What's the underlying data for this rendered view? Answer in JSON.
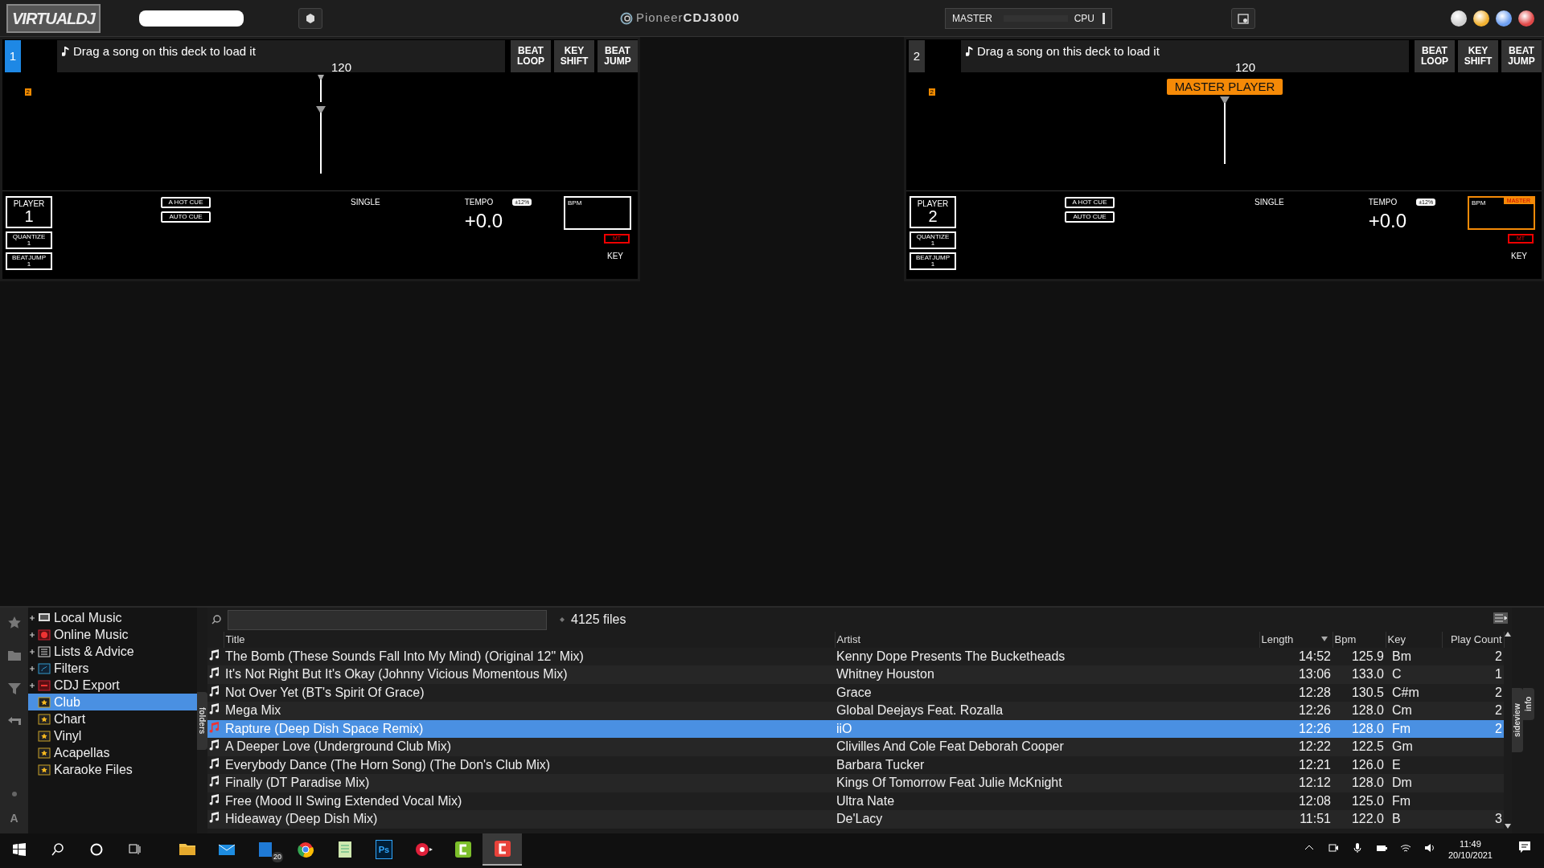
{
  "top_bar": {
    "logo": "VIRTUALDJ",
    "brand_prefix": "Pioneer",
    "brand_model": "CDJ3000",
    "master_label": "MASTER",
    "cpu_label": "CPU"
  },
  "decks": [
    {
      "number": "1",
      "selected": true,
      "master": false,
      "message": "Drag a song on this deck to load it",
      "bpm_display": "120",
      "buttons": [
        "BEAT LOOP",
        "KEY SHIFT",
        "BEAT JUMP"
      ],
      "cue_badge": "2",
      "player_label": "PLAYER",
      "player_number": "1",
      "quantize_label": "QUANTIZE",
      "quantize_value": "1",
      "beatjump_label": "BEATJUMP",
      "beatjump_value": "1",
      "cue_buttons": [
        "A HOT CUE",
        "AUTO CUE"
      ],
      "mode": "SINGLE",
      "tempo_label": "TEMPO",
      "tempo_range": "±12%",
      "tempo_value": "+0.0",
      "bpm_label": "BPM",
      "mt_label": "MT",
      "key_label": "KEY"
    },
    {
      "number": "2",
      "selected": false,
      "master": true,
      "master_player_label": "MASTER PLAYER",
      "master_badge": "MASTER",
      "message": "Drag a song on this deck to load it",
      "bpm_display": "120",
      "buttons": [
        "BEAT LOOP",
        "KEY SHIFT",
        "BEAT JUMP"
      ],
      "cue_badge": "2",
      "player_label": "PLAYER",
      "player_number": "2",
      "quantize_label": "QUANTIZE",
      "quantize_value": "1",
      "beatjump_label": "BEATJUMP",
      "beatjump_value": "1",
      "cue_buttons": [
        "A HOT CUE",
        "AUTO CUE"
      ],
      "mode": "SINGLE",
      "tempo_label": "TEMPO",
      "tempo_range": "±12%",
      "tempo_value": "+0.0",
      "bpm_label": "BPM",
      "mt_label": "MT",
      "key_label": "KEY"
    }
  ],
  "browser": {
    "tree": [
      {
        "label": "Local Music",
        "kind": "computer",
        "expandable": true,
        "selected": false
      },
      {
        "label": "Online Music",
        "kind": "online",
        "expandable": true,
        "selected": false
      },
      {
        "label": "Lists & Advice",
        "kind": "list",
        "expandable": true,
        "selected": false
      },
      {
        "label": "Filters",
        "kind": "filter",
        "expandable": true,
        "selected": false
      },
      {
        "label": "CDJ Export",
        "kind": "export",
        "expandable": true,
        "selected": false
      },
      {
        "label": "Club",
        "kind": "favorite",
        "expandable": false,
        "selected": true
      },
      {
        "label": "Chart",
        "kind": "favorite",
        "expandable": false,
        "selected": false
      },
      {
        "label": "Vinyl",
        "kind": "favorite",
        "expandable": false,
        "selected": false
      },
      {
        "label": "Acapellas",
        "kind": "favorite",
        "expandable": false,
        "selected": false
      },
      {
        "label": "Karaoke Files",
        "kind": "favorite",
        "expandable": false,
        "selected": false
      }
    ],
    "font_button": "A",
    "folders_tab": "folders",
    "file_count": "4125 files",
    "sideview_tab": "sideview",
    "info_tab": "info",
    "columns": [
      {
        "label": "Title",
        "sorted": false
      },
      {
        "label": "Artist",
        "sorted": false
      },
      {
        "label": "Length",
        "sorted": true
      },
      {
        "label": "Bpm",
        "sorted": false
      },
      {
        "label": "Key",
        "sorted": false
      },
      {
        "label": "Play Count",
        "sorted": false
      }
    ],
    "rows": [
      {
        "title": "The Bomb (These Sounds Fall Into My Mind) (Original 12\" Mix)",
        "artist": "Kenny Dope Presents The Bucketheads",
        "length": "14:52",
        "bpm": "125.9",
        "key": "Bm",
        "play_count": "2",
        "selected": false
      },
      {
        "title": "It's Not Right But It's Okay (Johnny Vicious Momentous Mix)",
        "artist": "Whitney Houston",
        "length": "13:06",
        "bpm": "133.0",
        "key": "C",
        "play_count": "1",
        "selected": false
      },
      {
        "title": "Not Over Yet (BT's Spirit Of Grace)",
        "artist": "Grace",
        "length": "12:28",
        "bpm": "130.5",
        "key": "C#m",
        "play_count": "2",
        "selected": false
      },
      {
        "title": "Mega Mix",
        "artist": "Global Deejays Feat. Rozalla",
        "length": "12:26",
        "bpm": "128.0",
        "key": "Cm",
        "play_count": "2",
        "selected": false
      },
      {
        "title": "Rapture (Deep Dish Space Remix)",
        "artist": "iiO",
        "length": "12:26",
        "bpm": "128.0",
        "key": "Fm",
        "play_count": "2",
        "selected": true
      },
      {
        "title": "A Deeper Love (Underground Club Mix)",
        "artist": "Clivilles And Cole Feat Deborah Cooper",
        "length": "12:22",
        "bpm": "122.5",
        "key": "Gm",
        "selected": false
      },
      {
        "title": "Everybody Dance (The Horn Song) (The Don's Club Mix)",
        "artist": "Barbara Tucker",
        "length": "12:21",
        "bpm": "126.0",
        "key": "E",
        "selected": false
      },
      {
        "title": "Finally (DT Paradise Mix)",
        "artist": "Kings Of Tomorrow Feat Julie McKnight",
        "length": "12:12",
        "bpm": "128.0",
        "key": "Dm",
        "selected": false
      },
      {
        "title": "Free (Mood II Swing Extended Vocal Mix)",
        "artist": "Ultra Nate",
        "length": "12:08",
        "bpm": "125.0",
        "key": "Fm",
        "selected": false
      },
      {
        "title": "Hideaway (Deep Dish Mix)",
        "artist": "De'Lacy",
        "length": "11:51",
        "bpm": "122.0",
        "key": "B",
        "play_count": "3",
        "selected": false
      }
    ]
  },
  "taskbar": {
    "apps": [
      {
        "kind": "folder",
        "active": false
      },
      {
        "kind": "mail",
        "active": false
      },
      {
        "kind": "tile",
        "badge": "20",
        "active": false
      },
      {
        "kind": "globe",
        "active": false
      },
      {
        "kind": "notepad",
        "active": false
      },
      {
        "kind": "text",
        "label": "Ps",
        "active": false
      },
      {
        "kind": "record",
        "active": false
      },
      {
        "kind": "green",
        "active": false
      },
      {
        "kind": "red",
        "active": true
      }
    ],
    "time": "11:49",
    "date": "20/10/2021"
  }
}
